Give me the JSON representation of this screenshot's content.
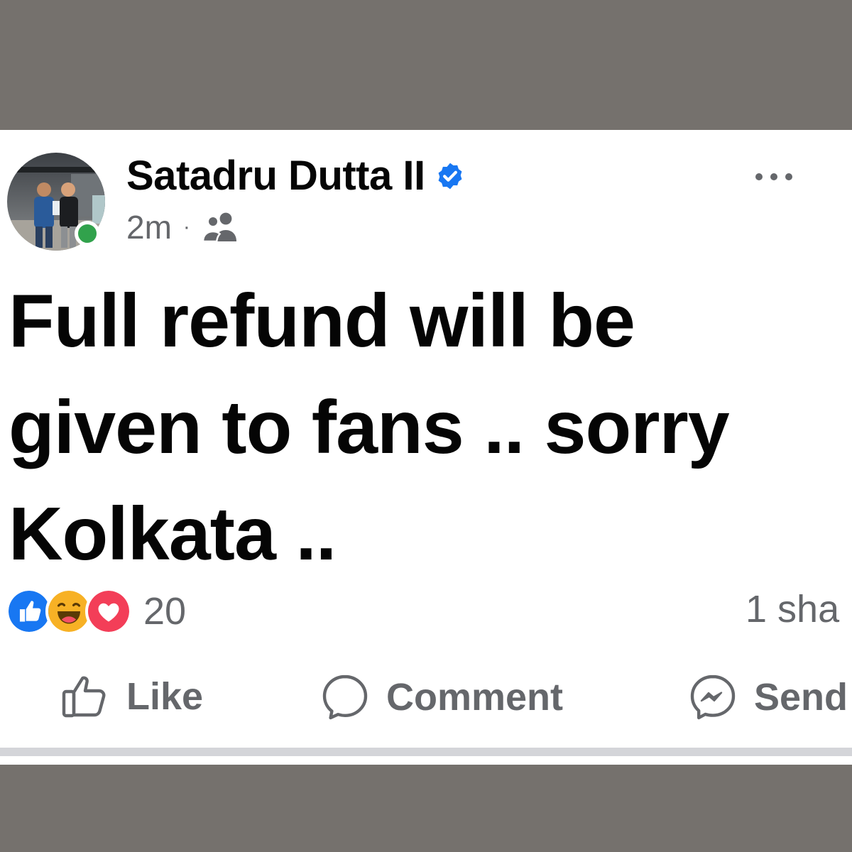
{
  "post": {
    "author": "Satadru Dutta II",
    "timestamp": "2m",
    "separator": "·",
    "audience_icon": "friends-icon",
    "verified_icon": "verified-badge-icon",
    "more_icon": "more-options-icon",
    "text_lines": [
      "Full refund will be",
      "given to fans .. sorry",
      "Kolkata .."
    ]
  },
  "reactions": {
    "icons": [
      "like-reaction-icon",
      "haha-reaction-icon",
      "love-reaction-icon"
    ],
    "count": "20",
    "shares": "1 sha"
  },
  "actions": {
    "like": "Like",
    "comment": "Comment",
    "send": "Send"
  },
  "colors": {
    "background_band": "#75716d",
    "card": "#ffffff",
    "text_primary": "#050505",
    "text_secondary": "#65676b",
    "verified_blue": "#1877f2",
    "online_green": "#31a24c",
    "like_blue": "#1877f2",
    "love_red": "#f33e58",
    "haha_yellow": "#f7b125"
  }
}
